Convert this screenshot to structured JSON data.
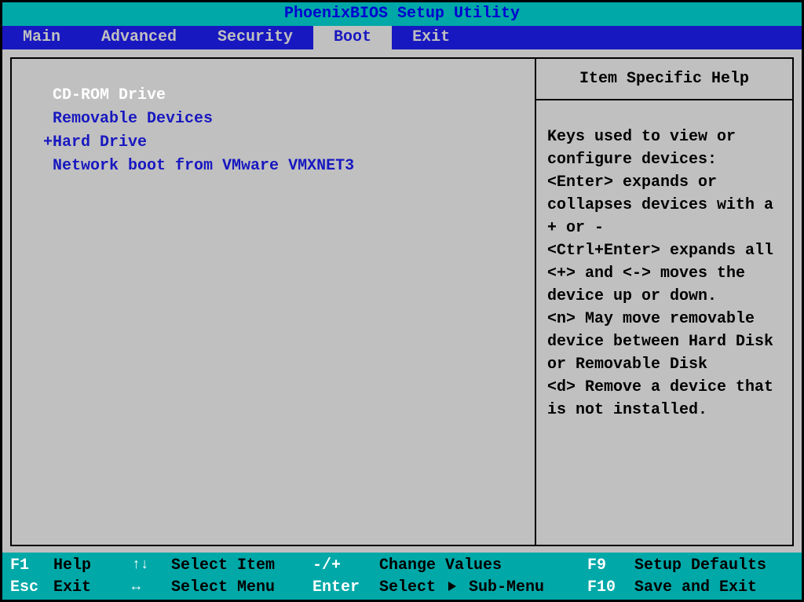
{
  "title": "PhoenixBIOS Setup Utility",
  "menu": {
    "items": [
      "Main",
      "Advanced",
      "Security",
      "Boot",
      "Exit"
    ],
    "active_index": 3
  },
  "boot": {
    "items": [
      {
        "prefix": " ",
        "label": "CD-ROM Drive",
        "selected": true
      },
      {
        "prefix": " ",
        "label": "Removable Devices",
        "selected": false
      },
      {
        "prefix": "+",
        "label": "Hard Drive",
        "selected": false
      },
      {
        "prefix": " ",
        "label": "Network boot from VMware VMXNET3",
        "selected": false
      }
    ]
  },
  "help": {
    "title": "Item Specific Help",
    "body": "Keys used to view or configure devices:\n<Enter> expands or collapses devices with a + or -\n<Ctrl+Enter> expands all\n<+> and <-> moves the device up or down.\n<n> May move removable device between Hard Disk or Removable Disk\n<d> Remove a device that is not installed."
  },
  "footer": {
    "r1": {
      "k1": "F1",
      "l1": "Help",
      "k2": "↑↓",
      "l2": "Select Item",
      "k3": "-/+",
      "l3": "Change Values",
      "k4": "F9",
      "l4": "Setup Defaults"
    },
    "r2": {
      "k1": "Esc",
      "l1": "Exit",
      "k2": "↔",
      "l2": "Select Menu",
      "k3": "Enter",
      "l3": "Select ▶ Sub-Menu",
      "k4": "F10",
      "l4": "Save and Exit"
    }
  }
}
